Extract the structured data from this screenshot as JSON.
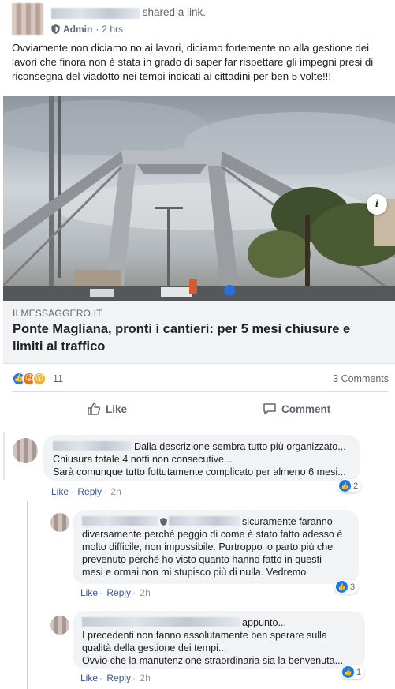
{
  "post": {
    "shared_text": "shared a link.",
    "role": "Admin",
    "time": "2 hrs",
    "body": "Ovviamente non diciamo no ai lavori, diciamo fortemente no alla gestione dei lavori che finora non è stata in grado di saper far rispettare gli impegni presi di riconsegna del viadotto nei tempi indicati ai cittadini per ben 5 volte!!!"
  },
  "link": {
    "domain": "ILMESSAGGERO.IT",
    "title": "Ponte Magliana, pronti i cantieri: per 5 mesi chiusure e limiti al traffico",
    "info_glyph": "i"
  },
  "stats": {
    "reaction_count": "11",
    "comment_count": "3 Comments"
  },
  "actions": {
    "like_label": "Like",
    "comment_label": "Comment"
  },
  "comments": [
    {
      "text_lines": [
        "Dalla descrizione sembra tutto più organizzato...",
        "Chiusura totale 4 notti non consecutive...",
        "Sarà comunque tutto fottutamente complicato per almeno 6 mesi..."
      ],
      "likes": "2",
      "like_label": "Like",
      "reply_label": "Reply",
      "time": "2h"
    },
    {
      "text_lines": [
        "sicuramente faranno",
        "diversamente perché peggio di come è stato fatto adesso è",
        "molto difficile, non impossibile. Purtroppo io parto più che",
        "prevenuto perché ho visto quanto hanno fatto in questi",
        "mesi e ormai non mi stupisco più di nulla. Vedremo"
      ],
      "likes": "3",
      "like_label": "Like",
      "reply_label": "Reply",
      "time": "2h"
    },
    {
      "text_lines": [
        "appunto...",
        "I precedenti non fanno assolutamente ben sperare sulla",
        "qualità della gestione dei tempi...",
        "Ovvio che la manutenzione straordinaria sia la benvenuta..."
      ],
      "likes": "1",
      "like_label": "Like",
      "reply_label": "Reply",
      "time": "2h"
    }
  ],
  "colors": {
    "link_blue": "#385898",
    "like_blue": "#1877f2",
    "secondary_gray": "#616770"
  }
}
